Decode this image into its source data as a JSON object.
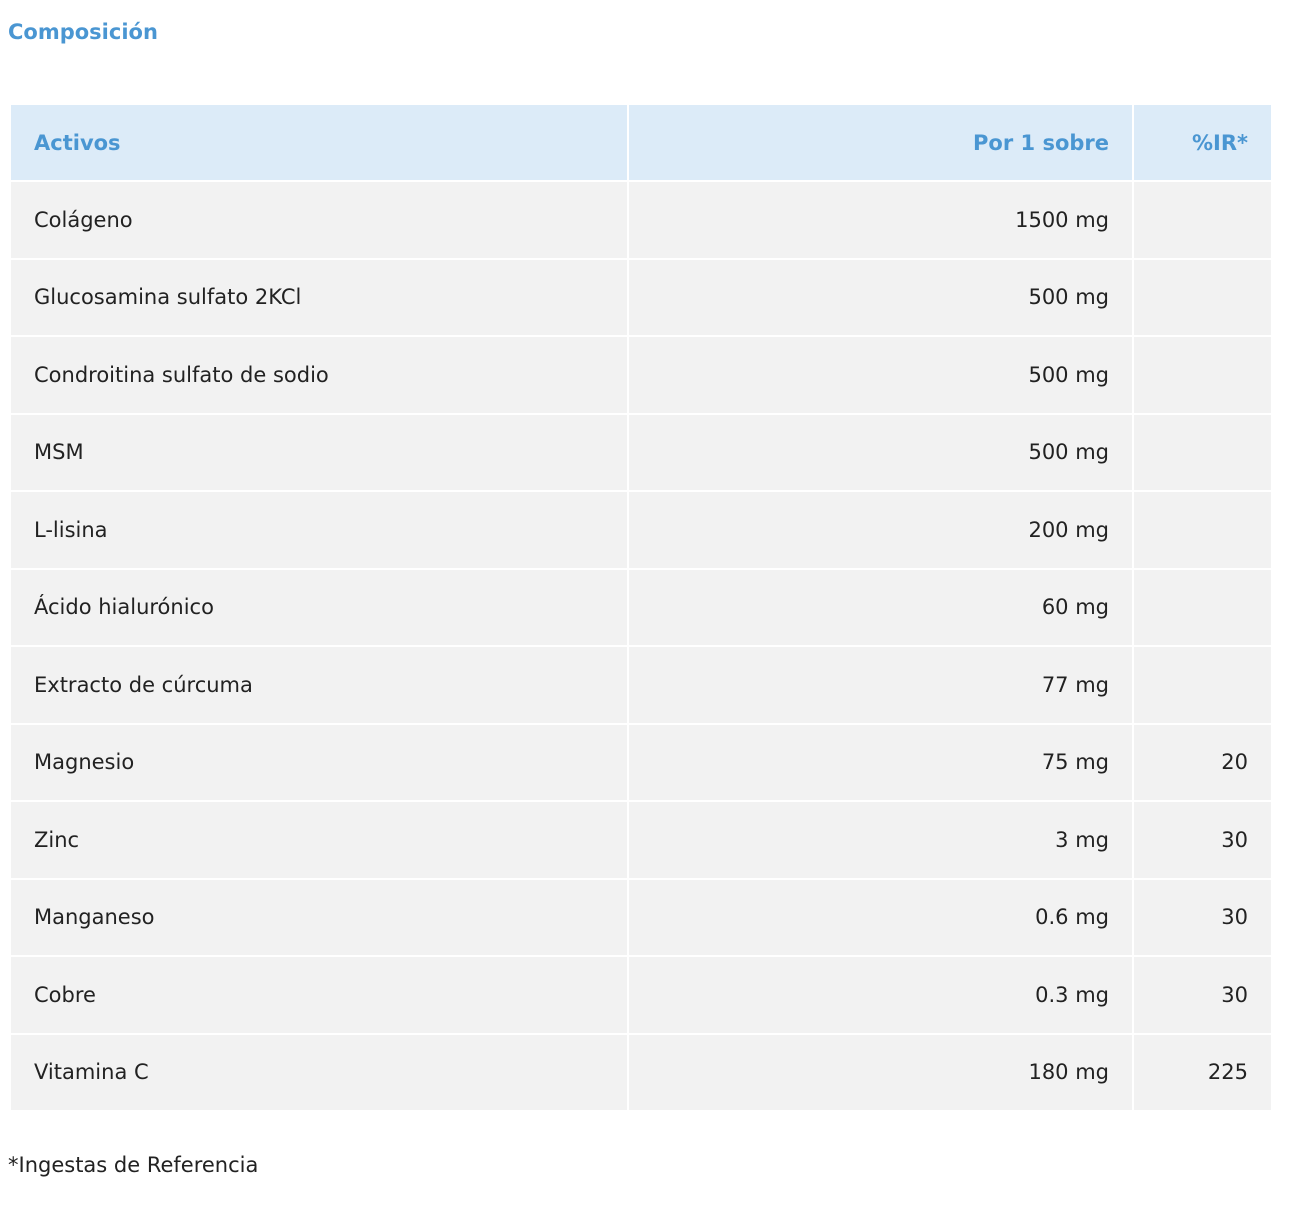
{
  "title": "Composición",
  "table": {
    "headers": [
      "Activos",
      "Por 1 sobre",
      "%IR*"
    ],
    "rows": [
      {
        "active": "Colágeno",
        "amount": "1500 mg",
        "ir": ""
      },
      {
        "active": "Glucosamina sulfato 2KCl",
        "amount": "500 mg",
        "ir": ""
      },
      {
        "active": "Condroitina sulfato de sodio",
        "amount": "500 mg",
        "ir": ""
      },
      {
        "active": "MSM",
        "amount": "500 mg",
        "ir": ""
      },
      {
        "active": "L-lisina",
        "amount": "200 mg",
        "ir": ""
      },
      {
        "active": "Ácido hialurónico",
        "amount": "60 mg",
        "ir": ""
      },
      {
        "active": "Extracto de cúrcuma",
        "amount": "77 mg",
        "ir": ""
      },
      {
        "active": "Magnesio",
        "amount": "75 mg",
        "ir": "20"
      },
      {
        "active": "Zinc",
        "amount": "3 mg",
        "ir": "30"
      },
      {
        "active": "Manganeso",
        "amount": "0.6 mg",
        "ir": "30"
      },
      {
        "active": "Cobre",
        "amount": "0.3 mg",
        "ir": "30"
      },
      {
        "active": "Vitamina C",
        "amount": "180 mg",
        "ir": "225"
      }
    ]
  },
  "footnote": "*Ingestas de Referencia",
  "colors": {
    "accent": "#4a96d2",
    "header_bg": "#dcebf8",
    "row_bg": "#f2f2f2"
  }
}
